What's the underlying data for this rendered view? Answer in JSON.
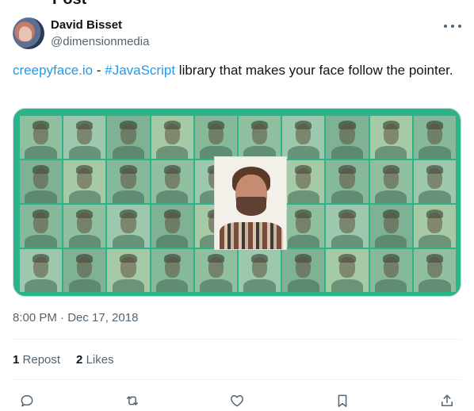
{
  "page": {
    "cut_header": "Post"
  },
  "author": {
    "display_name": "David Bisset",
    "handle": "@dimensionmedia"
  },
  "tweet": {
    "link_text": "creepyface.io",
    "separator": " - ",
    "hashtag": "#JavaScript",
    "text_rest": " library that makes your face follow the pointer."
  },
  "media": {
    "alt": "creepyface grid demo",
    "background": "#2bb38a"
  },
  "meta": {
    "timestamp": "8:00 PM · Dec 17, 2018"
  },
  "stats": {
    "reposts_count": "1",
    "reposts_label": "Repost",
    "likes_count": "2",
    "likes_label": "Likes"
  },
  "actions": [
    {
      "name": "reply-icon"
    },
    {
      "name": "repost-icon"
    },
    {
      "name": "like-icon"
    },
    {
      "name": "bookmark-icon"
    },
    {
      "name": "share-icon"
    }
  ],
  "colors": {
    "link": "#1d9bf0",
    "text": "#0f1419",
    "secondary": "#536471"
  }
}
